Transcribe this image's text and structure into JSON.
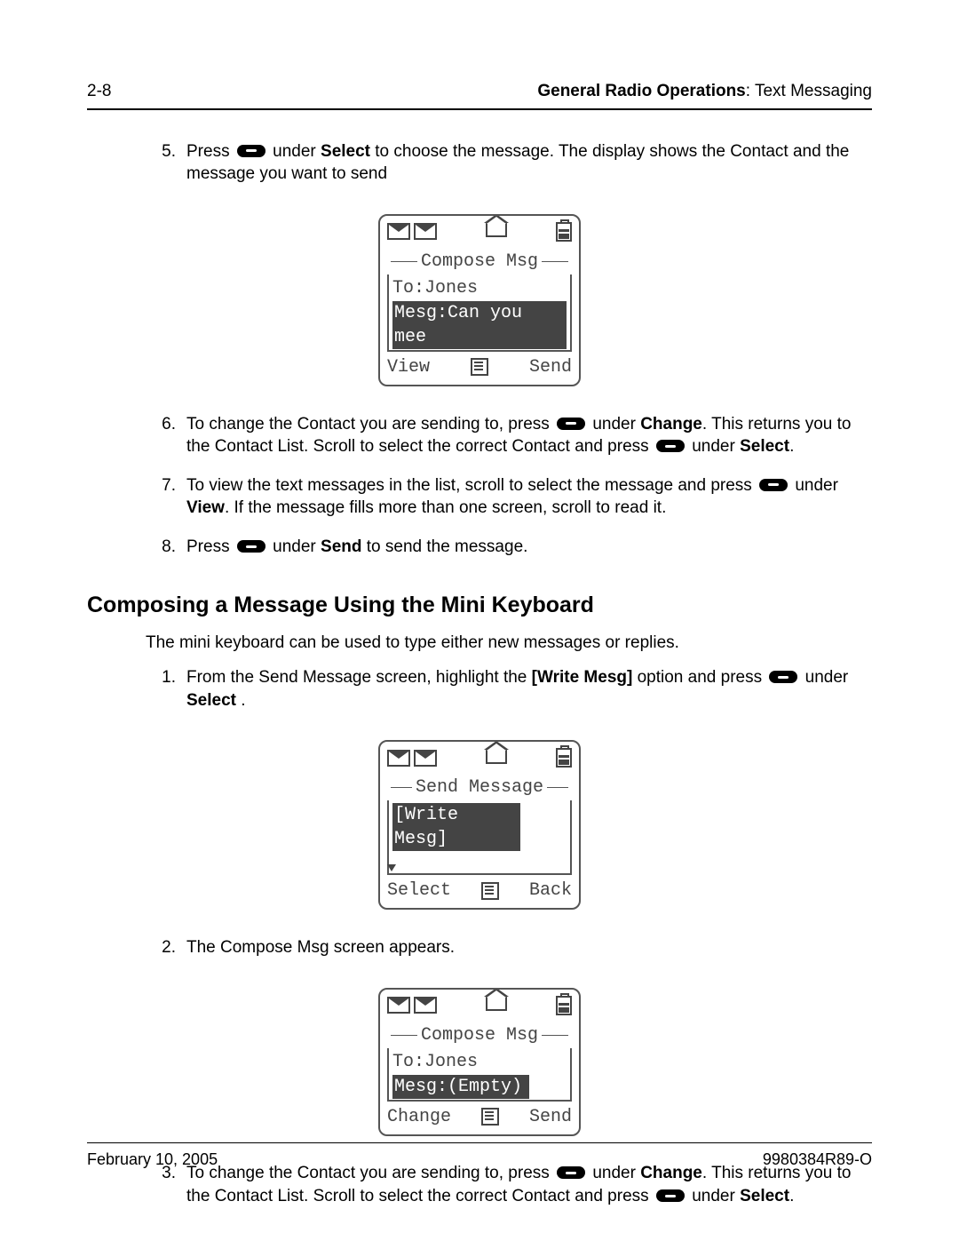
{
  "header": {
    "page_label": "2-8",
    "chapter_bold": "General Radio Operations",
    "chapter_rest": ": Text Messaging"
  },
  "steps_a": [
    {
      "num": "5.",
      "pre": "Press ",
      "post_key1": " under ",
      "word1": "Select",
      "tail": " to choose the message. The display shows the Contact and the message you want to send"
    },
    {
      "num": "6.",
      "pre": "To change the Contact you are sending to, press ",
      "post_key1": " under ",
      "word1": "Change",
      "mid": ". This returns you to the Contact List. Scroll to select the correct Contact and press ",
      "word2": "Select",
      "tail2": "."
    },
    {
      "num": "7.",
      "pre": "To view the text messages in the list, scroll to select the message and press ",
      "post_key1": " under ",
      "word1": "View",
      "tail": ". If the message fills more than one screen, scroll to read it."
    },
    {
      "num": "8.",
      "pre": "Press ",
      "post_key1": " under ",
      "word1": "Send",
      "tail": " to send the message."
    }
  ],
  "section_heading": "Composing a Message Using the Mini Keyboard",
  "intro": "The mini keyboard can be used to type either new messages or replies.",
  "steps_b": [
    {
      "num": "1.",
      "pre": "From the Send Message screen, highlight the ",
      "word0": "[Write Mesg]",
      "mid0": " option and press ",
      "post_key1": " under ",
      "word1": "Select",
      "tail": " ."
    },
    {
      "num": "2.",
      "text": "The Compose Msg screen appears."
    },
    {
      "num": "3.",
      "pre": "To change the Contact you are sending to, press ",
      "post_key1": " under ",
      "word1": "Change",
      "mid": ". This returns you to the Contact List. Scroll to select the correct Contact and press ",
      "word2": "Select",
      "tail2": "."
    }
  ],
  "screen1": {
    "title": "Compose Msg",
    "line1": "To:Jones",
    "line2": "Mesg:Can you mee",
    "soft_left": "View",
    "soft_right": "Send"
  },
  "screen2": {
    "title": "Send Message",
    "line_inv": "[Write Mesg]",
    "soft_left": "Select",
    "soft_right": "Back"
  },
  "screen3": {
    "title": "Compose Msg",
    "line1": "To:Jones",
    "line2": "Mesg:(Empty)",
    "soft_left": "Change",
    "soft_right": "Send"
  },
  "footer": {
    "left": "February 10, 2005",
    "right": "9980384R89-O"
  }
}
